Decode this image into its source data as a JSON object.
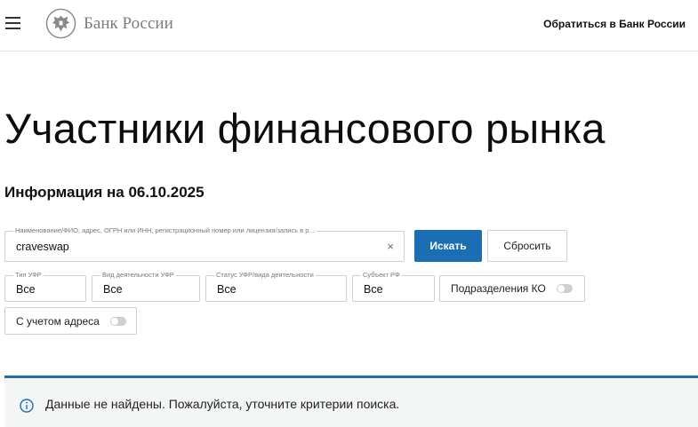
{
  "header": {
    "logo_text": "Банк России",
    "contact_link": "Обратиться в Банк России"
  },
  "main": {
    "title": "Участники финансового рынка",
    "info_date": "Информация на 06.10.2025"
  },
  "search": {
    "legend": "Наименование/ФИО, адрес, ОГРН или ИНН, регистрационный номер или лицензия/запись в р...",
    "value": "craveswap",
    "clear_glyph": "×",
    "search_button": "Искать",
    "reset_button": "Сбросить"
  },
  "filters": [
    {
      "legend": "Тип УФР",
      "value": "Все"
    },
    {
      "legend": "Вид деятельности УФР",
      "value": "Все"
    },
    {
      "legend": "Статус УФР/вида деятельности",
      "value": "Все"
    },
    {
      "legend": "Субъект РФ",
      "value": "Все"
    }
  ],
  "toggles": {
    "branches_label": "Подразделения КО",
    "address_label": "С учетом адреса"
  },
  "notice": {
    "text": "Данные не найдены. Пожалуйста, уточните критерии поиска."
  },
  "colors": {
    "accent": "#1a6fb4",
    "notice_bg": "#f4f6f6"
  },
  "icons": {
    "menu": "hamburger-menu-icon",
    "emblem": "double-headed-eagle-emblem-icon",
    "info": "info-circle-icon"
  }
}
